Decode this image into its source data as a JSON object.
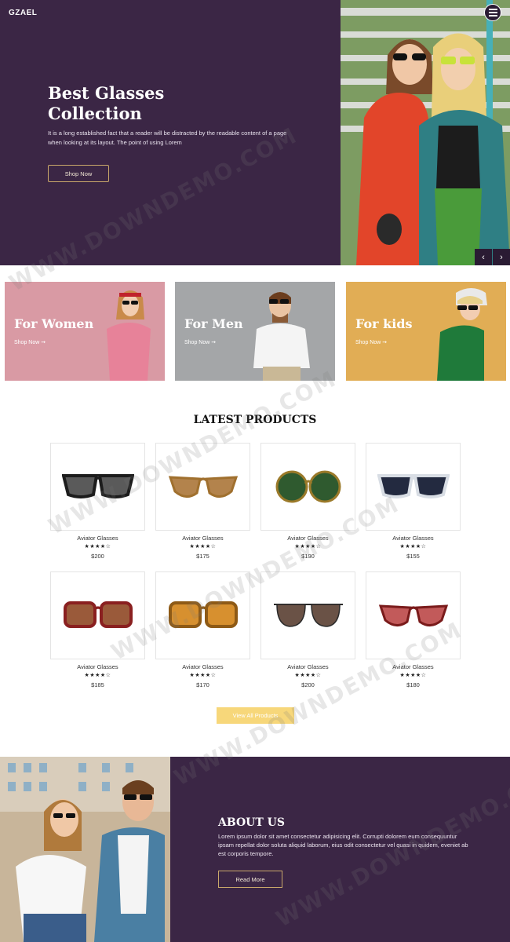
{
  "brand": "GZAEL",
  "hero": {
    "title_line1": "Best Glasses",
    "title_line2": "Collection",
    "text": "It is a long established fact that a reader will be distracted by the readable content of a page when looking at its layout. The point of using Lorem",
    "button": "Shop Now",
    "prev": "‹",
    "next": "›"
  },
  "categories": [
    {
      "title": "For Women",
      "link": "Shop Now ➞",
      "color": "#d99aa4"
    },
    {
      "title": "For Men",
      "link": "Shop Now ➞",
      "color": "#a4a6a8"
    },
    {
      "title": "For kids",
      "link": "Shop Now ➞",
      "color": "#e1ad55"
    }
  ],
  "products": {
    "title": "LATEST PRODUCTS",
    "items": [
      {
        "name": "Aviator Glasses",
        "stars": "★★★★☆",
        "price": "$200",
        "frame": "#1c1c1c",
        "lens": "#5a5a5a",
        "shape": "wayfarer"
      },
      {
        "name": "Aviator Glasses",
        "stars": "★★★★☆",
        "price": "$175",
        "frame": "#a0702e",
        "lens": "#b3834c",
        "shape": "cat"
      },
      {
        "name": "Aviator Glasses",
        "stars": "★★★★☆",
        "price": "$190",
        "frame": "#9b7a2a",
        "lens": "#2f5a2f",
        "shape": "round"
      },
      {
        "name": "Aviator Glasses",
        "stars": "★★★★☆",
        "price": "$155",
        "frame": "#d8dde4",
        "lens": "#232a40",
        "shape": "wayfarer"
      },
      {
        "name": "Aviator Glasses",
        "stars": "★★★★☆",
        "price": "$185",
        "frame": "#8a2020",
        "lens": "#9a5a3a",
        "shape": "square"
      },
      {
        "name": "Aviator Glasses",
        "stars": "★★★★☆",
        "price": "$170",
        "frame": "#8e5a16",
        "lens": "#d7902f",
        "shape": "square"
      },
      {
        "name": "Aviator Glasses",
        "stars": "★★★★☆",
        "price": "$200",
        "frame": "#2b2b2b",
        "lens": "#6a5246",
        "shape": "aviator"
      },
      {
        "name": "Aviator Glasses",
        "stars": "★★★★☆",
        "price": "$180",
        "frame": "#7a1b1b",
        "lens": "#c25a5a",
        "shape": "cat"
      }
    ],
    "view_all": "View All Products"
  },
  "about": {
    "title": "ABOUT US",
    "text": "Lorem ipsum dolor sit amet consectetur adipisicing elit. Corrupti dolorem eum consequuntur ipsam repellat dolor soluta aliquid laborum, eius odit consectetur vel quasi in quidem, eveniet ab est corporis tempore.",
    "button": "Read More"
  },
  "watermark": "WWW.DOWNDEMO.COM",
  "colors": {
    "primary": "#3b2645",
    "accent": "#c9a86a",
    "button_yellow": "#f7d77a"
  }
}
